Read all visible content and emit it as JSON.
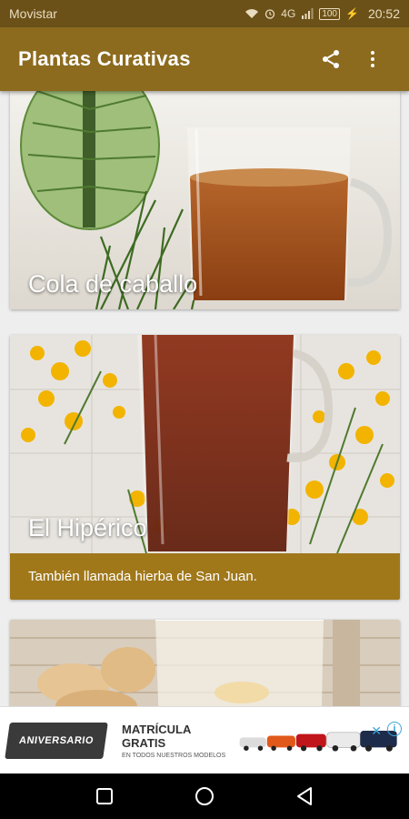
{
  "status_bar": {
    "carrier": "Movistar",
    "battery": "100",
    "time": "20:52",
    "network": "4G"
  },
  "app_bar": {
    "title": "Plantas Curativas",
    "icons": [
      "share-icon",
      "more-vert-icon"
    ]
  },
  "plants": [
    {
      "name": "Cola de caballo",
      "subtitle": ""
    },
    {
      "name": "El Hipérico",
      "subtitle": "También llamada hierba de San Juan."
    },
    {
      "name": "",
      "subtitle": ""
    }
  ],
  "ad": {
    "badge": "ANIVERSARIO",
    "headline": "MATRÍCULA GRATIS",
    "subline": "EN TODOS NUESTROS MODELOS"
  },
  "navigation": {
    "icons": [
      "recents-square-icon",
      "home-circle-icon",
      "back-triangle-icon"
    ]
  },
  "colors": {
    "primary": "#8c6b1f",
    "primary_dark": "#6b5118",
    "subtitle_band": "#a0781a"
  }
}
